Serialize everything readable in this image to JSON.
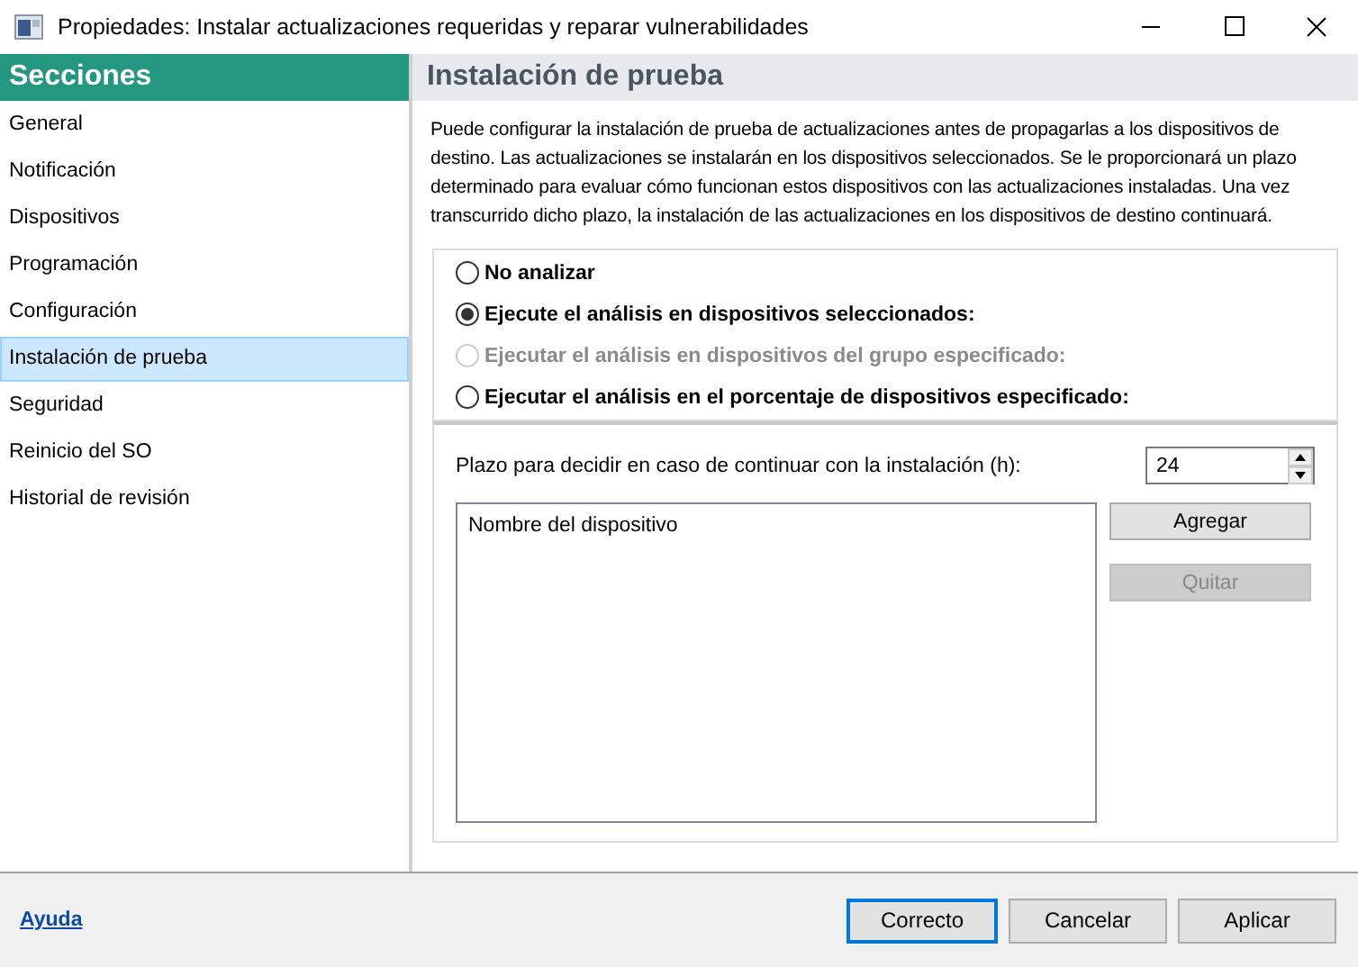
{
  "window": {
    "title": "Propiedades: Instalar actualizaciones requeridas y reparar vulnerabilidades"
  },
  "sidebar": {
    "title": "Secciones",
    "items": [
      {
        "label": "General",
        "selected": false
      },
      {
        "label": "Notificación",
        "selected": false
      },
      {
        "label": "Dispositivos",
        "selected": false
      },
      {
        "label": "Programación",
        "selected": false
      },
      {
        "label": "Configuración",
        "selected": false
      },
      {
        "label": "Instalación de prueba",
        "selected": true
      },
      {
        "label": "Seguridad",
        "selected": false
      },
      {
        "label": "Reinicio del SO",
        "selected": false
      },
      {
        "label": "Historial de revisión",
        "selected": false
      }
    ]
  },
  "section": {
    "title": "Instalación de prueba",
    "description": "Puede configurar la instalación de prueba de actualizaciones antes de propagarlas a los dispositivos de destino. Las actualizaciones se instalarán en los dispositivos seleccionados. Se le proporcionará un plazo determinado para evaluar cómo funcionan estos dispositivos con las actualizaciones instaladas. Una vez transcurrido dicho plazo, la instalación de las actualizaciones en los dispositivos de destino continuará."
  },
  "options": [
    {
      "label": "No analizar",
      "selected": false,
      "disabled": false
    },
    {
      "label": "Ejecute el análisis en dispositivos seleccionados:",
      "selected": true,
      "disabled": false
    },
    {
      "label": "Ejecutar el análisis en dispositivos del grupo especificado:",
      "selected": false,
      "disabled": true
    },
    {
      "label": "Ejecutar el análisis en el porcentaje de dispositivos especificado:",
      "selected": false,
      "disabled": false
    }
  ],
  "timeout": {
    "label": "Plazo para decidir en caso de continuar con la instalación (h):",
    "value": "24"
  },
  "device_list": {
    "column": "Nombre del dispositivo"
  },
  "list_buttons": [
    {
      "label": "Agregar",
      "disabled": false
    },
    {
      "label": "Quitar",
      "disabled": true
    }
  ],
  "help_link": "Ayuda",
  "buttons": [
    {
      "label": "Correcto",
      "default": true
    },
    {
      "label": "Cancelar",
      "default": false
    },
    {
      "label": "Aplicar",
      "default": false
    }
  ]
}
